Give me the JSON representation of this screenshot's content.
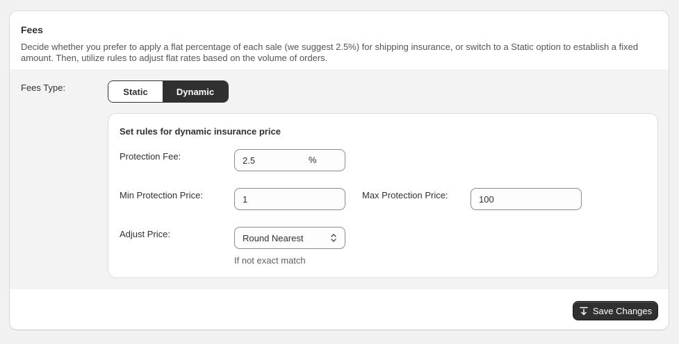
{
  "card": {
    "title": "Fees",
    "description": "Decide whether you prefer to apply a flat percentage of each sale (we suggest 2.5%) for shipping insurance, or switch to a Static option to establish a fixed amount. Then, utilize rules to adjust flat rates based on the volume of orders."
  },
  "fees_type": {
    "label": "Fees Type:",
    "options": [
      "Static",
      "Dynamic"
    ],
    "selected": "Dynamic"
  },
  "rules": {
    "title": "Set rules for dynamic insurance price",
    "protection_fee": {
      "label": "Protection Fee:",
      "value": "2.5",
      "suffix": "%"
    },
    "min_protection_price": {
      "label": "Min Protection Price:",
      "value": "1"
    },
    "max_protection_price": {
      "label": "Max Protection Price:",
      "value": "100"
    },
    "adjust_price": {
      "label": "Adjust Price:",
      "value": "Round Nearest",
      "hint": "If not exact match"
    }
  },
  "footer": {
    "save_label": "Save Changes"
  },
  "icons": {
    "save": "save-icon",
    "select": "chevron-up-down-icon"
  },
  "colors": {
    "accent": "#303030",
    "page_bg": "#f1f1f1",
    "section_bg": "#f3f3f3"
  }
}
